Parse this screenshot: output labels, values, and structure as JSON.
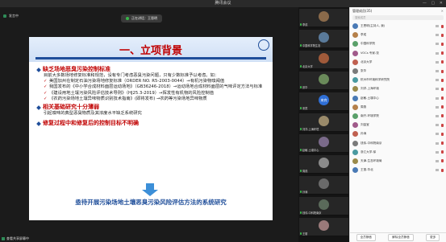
{
  "window": {
    "title": "腾讯会议"
  },
  "stage": {
    "presenter_name": "发言中",
    "pill_text": "正在讲话：王恩明",
    "share_label": "查看共享屏幕中"
  },
  "slide": {
    "title": "一、立项背景",
    "sections": [
      {
        "heading": "缺乏场地恶臭污染控制标准",
        "paragraph": "目前大多数场地修复标准和规范，没有专门考虑恶臭污染问题，只有少数标准予以考虑。如：",
        "items": [
          "美国加州在制定石油污染场地修复标准（ORDER NO. R5-2003-0044）→有机污染物嗅阈值",
          "我国发布的《中小学合成材料面层运动场地》（GB36246-2018）→运动场地合成材料面层的气味评定方法与标准",
          "《建设用地土壤污染风险评估技术导则》（HJ25.3-2019）→挥发性有机物的风险控制值",
          "《农药污染场地土壤异味物质识别技术指南》(即将发布) →农药等污染场地异味物质"
        ]
      },
      {
        "heading": "相关基础研究十分薄弱",
        "paragraph": "引起嗅味的典型恶臭物质及其浓度水平缺乏系统研究",
        "items": []
      },
      {
        "heading": "修复过程中和修复后的控制目标不明确",
        "paragraph": "",
        "items": []
      }
    ],
    "conclusion": "亟待开展污染场地土壤恶臭污染风险评估方法的系统研究"
  },
  "videos": [
    {
      "name": "李成",
      "color": "#8a6a4a"
    },
    {
      "name": "中国科学院生态",
      "color": "#5a7a9a"
    },
    {
      "name": "北京大学",
      "color": "#a05a3a"
    },
    {
      "name": "张华",
      "color": "#6a8a5a"
    },
    {
      "name": "来宾",
      "color": "#2f6fd6",
      "initial": "来宾"
    },
    {
      "name": "刘洋-上海环境",
      "color": "#9a8a6a"
    },
    {
      "name": "赵敏-土壤中心",
      "color": "#7a6a8a"
    },
    {
      "name": "周燕",
      "color": "#8a8a8a"
    },
    {
      "name": "孙涛",
      "color": "#6a6a6a"
    },
    {
      "name": "钱伟-中科院南京",
      "color": "#5a6a5a"
    },
    {
      "name": "王丽",
      "color": "#9a7a7a"
    }
  ],
  "participants": {
    "header": "管理成员(35)",
    "search_placeholder": "搜索成员",
    "list": [
      "王恩明(主持人, 我)",
      "李成",
      "中国科学院",
      "VOCs 专家-张",
      "北京大学",
      "张华",
      "杭州市环境科学研究院",
      "刘洋-上海环境",
      "赵敏-土壤中心",
      "周燕",
      "南开-环境学院",
      "刘金宝",
      "孙涛",
      "钱伟-中科院南京",
      "浙江大学-徐",
      "天津-生态环境局",
      "王丽-华北"
    ],
    "footer_buttons": [
      "全员静音",
      "解除全员静音",
      "更多"
    ]
  }
}
